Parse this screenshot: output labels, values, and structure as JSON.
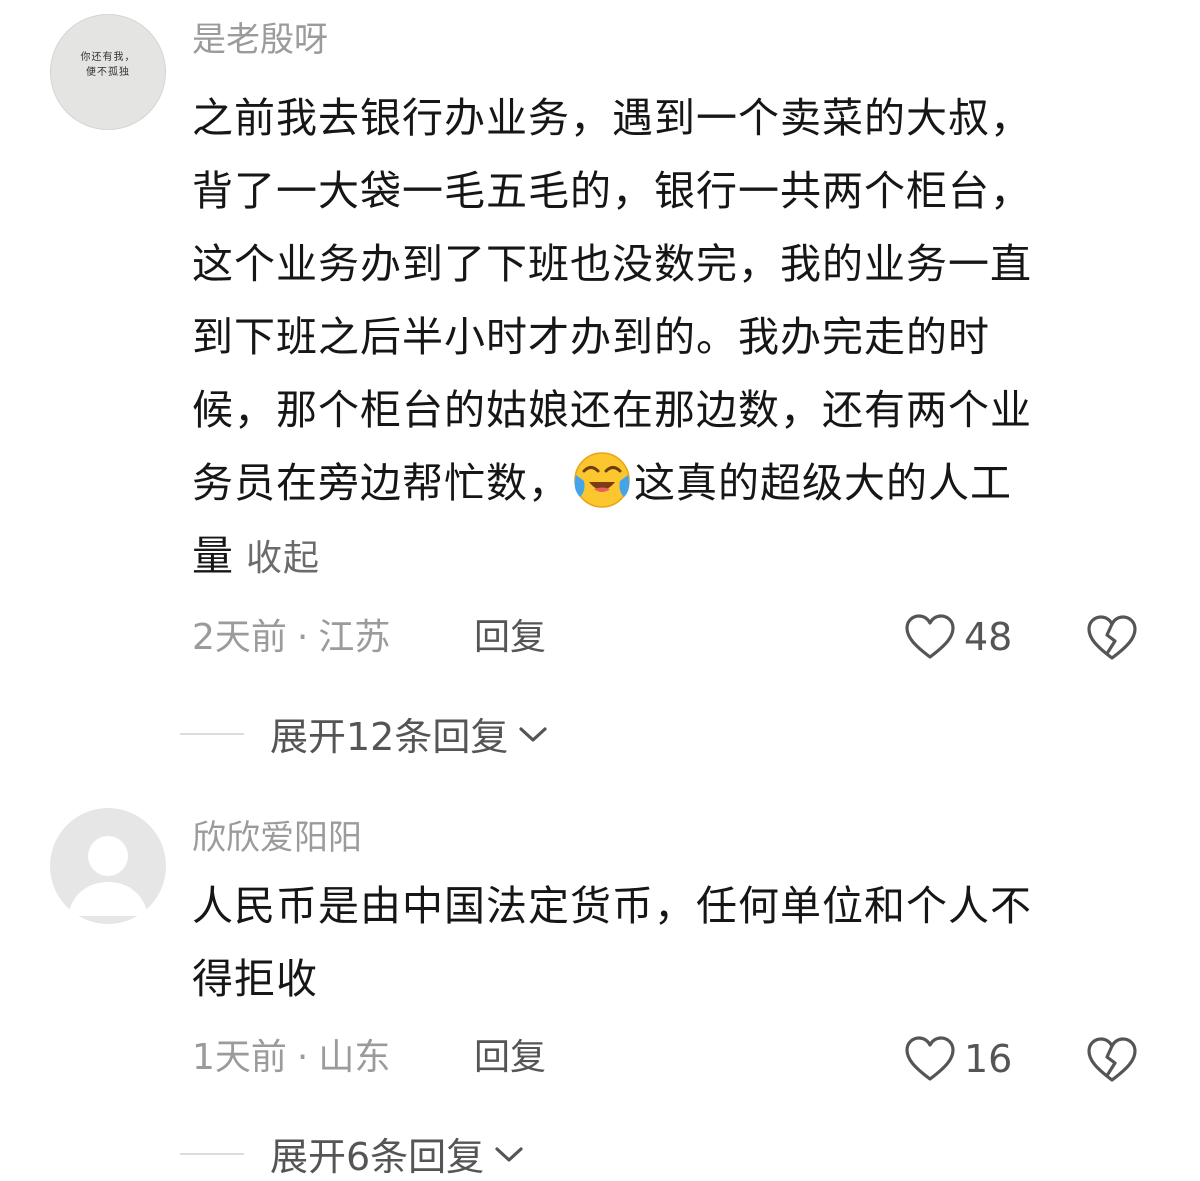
{
  "comments": [
    {
      "avatar_text": [
        "你还有我，",
        "便不孤独"
      ],
      "username": "是老殷呀",
      "lines": [
        "之前我去银行办业务，遇到一个卖菜的大叔，",
        "背了一大袋一毛五毛的，银行一共两个柜台，",
        "这个业务办到了下班也没数完，我的业务一直",
        "到下班之后半小时才办到的。我办完走的时",
        "候，那个柜台的姑娘还在那边数，还有两个业"
      ],
      "line6_before": "务员在旁边帮忙数，",
      "line6_emoji": "crying-laughing-emoji",
      "line6_after": "这真的超级大的人工",
      "line7": "量",
      "collapse": "收起",
      "time": "2天前",
      "dot": "·",
      "location": "江苏",
      "reply": "回复",
      "likes": "48",
      "expand": "展开12条回复"
    },
    {
      "username": "欣欣爱阳阳",
      "lines": [
        "人民币是由中国法定货币，任何单位和个人不",
        "得拒收"
      ],
      "time": "1天前",
      "dot": "·",
      "location": "山东",
      "reply": "回复",
      "likes": "16",
      "expand": "展开6条回复"
    }
  ],
  "icons": {
    "like": "heart-outline-icon",
    "dislike": "broken-heart-icon",
    "expand": "chevron-down-icon",
    "default_avatar": "person-silhouette-icon"
  },
  "colors": {
    "text": "#161616",
    "secondary": "#9b9b9b",
    "action": "#555555"
  }
}
